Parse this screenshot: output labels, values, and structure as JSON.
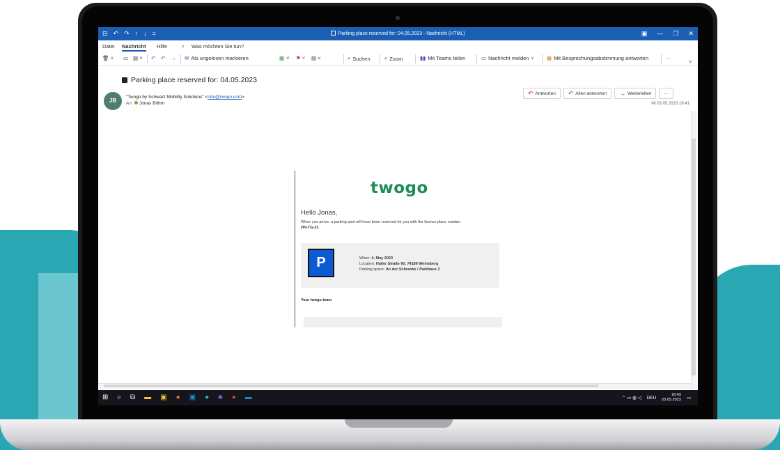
{
  "window": {
    "title": "Parking place reserved for: 04.05.2023  -  Nachricht (HTML)",
    "controls": [
      "▣",
      "—",
      "❐",
      "✕"
    ],
    "qat": [
      "⊟",
      "↶",
      "↷",
      "↑",
      "↓",
      "="
    ]
  },
  "menu": {
    "items": [
      "Datei",
      "Nachricht",
      "Hilfe"
    ],
    "search_label": "Was möchten Sie tun?",
    "active": "Nachricht"
  },
  "ribbon": {
    "mark_unread": "Als ungelesen markieren",
    "search": "Suchen",
    "zoom": "Zoom",
    "teams": "Mit Teams teilen",
    "report": "Nachricht melden",
    "meeting_reply": "Mit Besprechungsabstimmung antworten",
    "more": "···"
  },
  "message": {
    "subject": "Parking place reserved for: 04.05.2023",
    "avatar_initials": "JB",
    "from_name": "\"Twogo by Schwarz Mobility Solutions\" <",
    "from_email": "ride@twogo.com",
    "from_end": ">",
    "to_label": "An",
    "to_name": "Jonas Böhm",
    "date": "Mi 03.05.2023 16:41",
    "actions": {
      "reply": "Antworten",
      "reply_all": "Allen antworten",
      "forward": "Weiterleiten",
      "more": "···"
    }
  },
  "email_body": {
    "logo": "twogo",
    "greeting": "Hello Jonas,",
    "intro_text": "When you arrive, a parking spot will have been reserved for you with the licence place number",
    "plate": "HN-TG-23",
    "plate_suffix": ".",
    "parking_sign": "P",
    "when_label": "When: ",
    "when_value": "4. May 2023",
    "location_label": "Location: ",
    "location_value": "Haller Straße 60, 74189 Weinsberg",
    "space_label": "Parking space: ",
    "space_value": "An der Schranke / Parkhaus 2",
    "signoff": "Your twogo team"
  },
  "taskbar": {
    "language": "DEU",
    "time": "16:43",
    "date": "03.05.2023"
  },
  "colors": {
    "title_bar": "#1a5fb4",
    "brand_green": "#1c8e55",
    "brand_teal": "#2aa7b3",
    "parking_blue": "#0a5bd4"
  }
}
